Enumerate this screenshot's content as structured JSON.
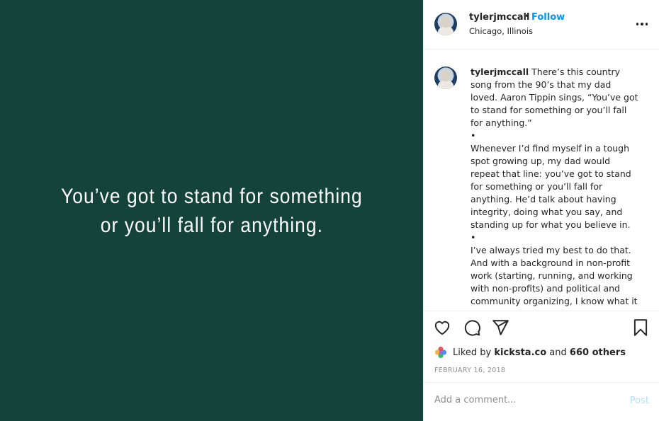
{
  "media": {
    "quote_line1": "You’ve got to stand for something",
    "quote_line2": "or you’ll fall for anything.",
    "background": "#14433a"
  },
  "header": {
    "username": "tylerjmccall",
    "separator": "•",
    "follow_label": "Follow",
    "location": "Chicago, Illinois",
    "more_icon": "more-horizontal-icon"
  },
  "caption": {
    "username": "tylerjmccall",
    "p1": "There’s this country song from the 90’s that my dad loved. Aaron Tippin sings, “You’ve got to stand for something or you’ll fall for anything.”",
    "sep1": "•",
    "p2": "Whenever I’d find myself in a tough spot growing up, my dad would repeat that line: you’ve got to stand for something or you’ll fall for anything. He’d talk about having integrity, doing what you say, and standing up for what you believe in.",
    "sep2": "•",
    "p3": "I’ve always tried my best to do that. And with a background in non-profit work (starting, running, and working with non-profits) and political and community organizing, I know what it"
  },
  "actions": {
    "like_icon": "heart-icon",
    "comment_icon": "comment-icon",
    "share_icon": "paper-plane-icon",
    "save_icon": "bookmark-icon"
  },
  "likes": {
    "prefix": "Liked by",
    "liker": "kicksta.co",
    "conj": "and",
    "others": "660 others"
  },
  "date": "FEBRUARY 16, 2018",
  "comment": {
    "placeholder": "Add a comment...",
    "post_label": "Post"
  },
  "colors": {
    "accent": "#0095f6",
    "post_disabled": "#b2dffc",
    "muted": "#8e8e8e"
  }
}
